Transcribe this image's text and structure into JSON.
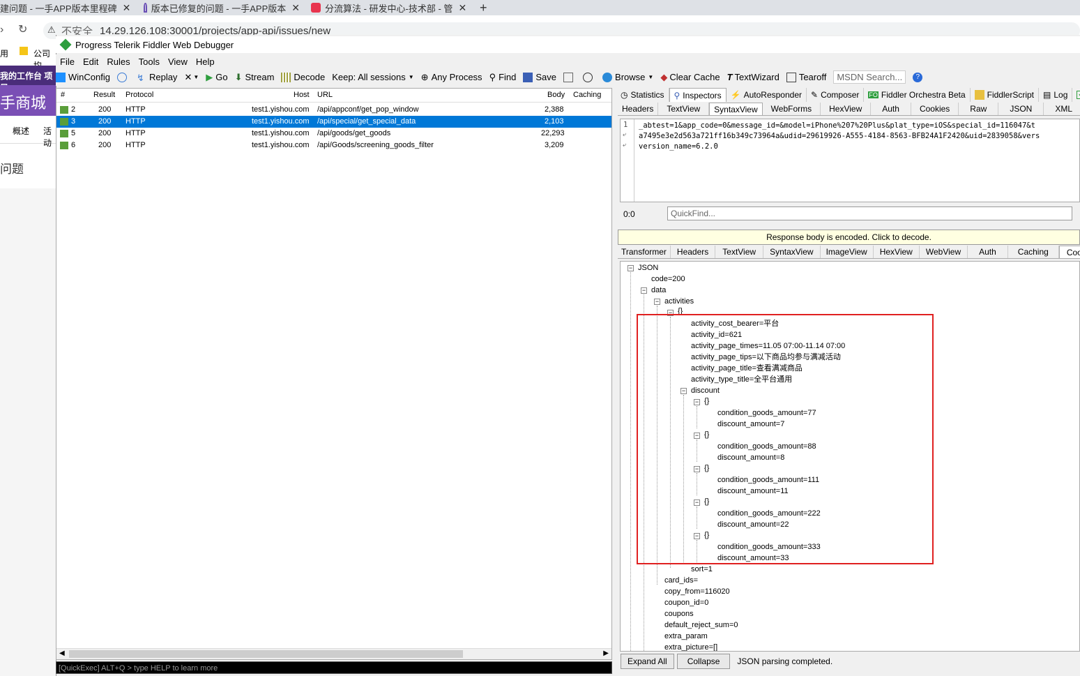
{
  "browser": {
    "tabs": [
      {
        "title": "建问题 - 一手APP版本里程碑",
        "close": "✕"
      },
      {
        "title": "版本已修复的问题 - 一手APP版本",
        "close": "✕"
      },
      {
        "title": "分流算法 - 研发中心-技术部 - 管",
        "close": "✕"
      }
    ],
    "new_tab": "+",
    "security": "不安全",
    "url": "14.29.126.108:30001/projects/app-api/issues/new",
    "bookmark_apps": "用",
    "bookmark_folder": "公司均"
  },
  "webpage": {
    "nav_text": "我的工作台  项目",
    "brand": "手商城需",
    "tab_overview": "概述",
    "tab_activity": "活动",
    "heading": "问题"
  },
  "fiddler": {
    "title": "Progress Telerik Fiddler Web Debugger",
    "menu": [
      "File",
      "Edit",
      "Rules",
      "Tools",
      "View",
      "Help"
    ],
    "toolbar": {
      "winconfig": "WinConfig",
      "replay": "Replay",
      "remove": "✕",
      "go": "Go",
      "stream": "Stream",
      "decode": "Decode",
      "keep": "Keep: All sessions",
      "process": "Any Process",
      "find": "Find",
      "save": "Save",
      "browse": "Browse",
      "clear_cache": "Clear Cache",
      "textwizard": "TextWizard",
      "tearoff": "Tearoff",
      "msdn": "MSDN Search..."
    },
    "sessions": {
      "columns": [
        "#",
        "Result",
        "Protocol",
        "Host",
        "URL",
        "Body",
        "Caching"
      ],
      "rows": [
        {
          "id": "2",
          "result": "200",
          "protocol": "HTTP",
          "host": "test1.yishou.com",
          "url": "/api/appconf/get_pop_window",
          "body": "2,388",
          "selected": false
        },
        {
          "id": "3",
          "result": "200",
          "protocol": "HTTP",
          "host": "test1.yishou.com",
          "url": "/api/special/get_special_data",
          "body": "2,103",
          "selected": true
        },
        {
          "id": "5",
          "result": "200",
          "protocol": "HTTP",
          "host": "test1.yishou.com",
          "url": "/api/goods/get_goods",
          "body": "22,293",
          "selected": false
        },
        {
          "id": "6",
          "result": "200",
          "protocol": "HTTP",
          "host": "test1.yishou.com",
          "url": "/api/Goods/screening_goods_filter",
          "body": "3,209",
          "selected": false
        }
      ],
      "quickexec": "[QuickExec] ALT+Q > type HELP to learn more"
    },
    "inspector_tabs": [
      "Statistics",
      "Inspectors",
      "AutoResponder",
      "Composer",
      "Fiddler Orchestra Beta",
      "FiddlerScript",
      "Log"
    ],
    "request_tabs": [
      "Headers",
      "TextView",
      "SyntaxView",
      "WebForms",
      "HexView",
      "Auth",
      "Cookies",
      "Raw",
      "JSON",
      "XML"
    ],
    "request_lines": [
      "_abtest=1&app_code=0&message_id=&model=iPhone%207%20Plus&plat_type=iOS&special_id=116047&t",
      "a7495e3e2d563a721ff16b349c73964a&udid=29619926-A555-4184-8563-BFB24A1F2420&uid=2839058&vers",
      "version_name=6.2.0"
    ],
    "line_numbers": [
      "1"
    ],
    "position": "0:0",
    "quickfind": "QuickFind...",
    "encoded_notice": "Response body is encoded. Click to decode.",
    "response_tabs": [
      "Transformer",
      "Headers",
      "TextView",
      "SyntaxView",
      "ImageView",
      "HexView",
      "WebView",
      "Auth",
      "Caching",
      "Cookies"
    ],
    "tree": {
      "root": "JSON",
      "code": "code=200",
      "data": "data",
      "activities": "activities",
      "obj": "{}",
      "fields": [
        "activity_cost_bearer=平台",
        "activity_id=621",
        "activity_page_times=11.05 07:00-11.14 07:00",
        "activity_page_tips=以下商品均参与满减活动",
        "activity_page_title=查看满减商品",
        "activity_type_title=全平台通用"
      ],
      "discount": "discount",
      "discounts": [
        {
          "cond": "condition_goods_amount=77",
          "amt": "discount_amount=7"
        },
        {
          "cond": "condition_goods_amount=88",
          "amt": "discount_amount=8"
        },
        {
          "cond": "condition_goods_amount=111",
          "amt": "discount_amount=11"
        },
        {
          "cond": "condition_goods_amount=222",
          "amt": "discount_amount=22"
        },
        {
          "cond": "condition_goods_amount=333",
          "amt": "discount_amount=33"
        }
      ],
      "sort": "sort=1",
      "data_fields": [
        "card_ids=",
        "copy_from=116020",
        "coupon_id=0",
        "coupons",
        "default_reject_sum=0",
        "extra_param",
        "extra_picture=[]"
      ]
    },
    "bottom": {
      "expand": "Expand All",
      "collapse": "Collapse",
      "status": "JSON parsing completed."
    }
  }
}
